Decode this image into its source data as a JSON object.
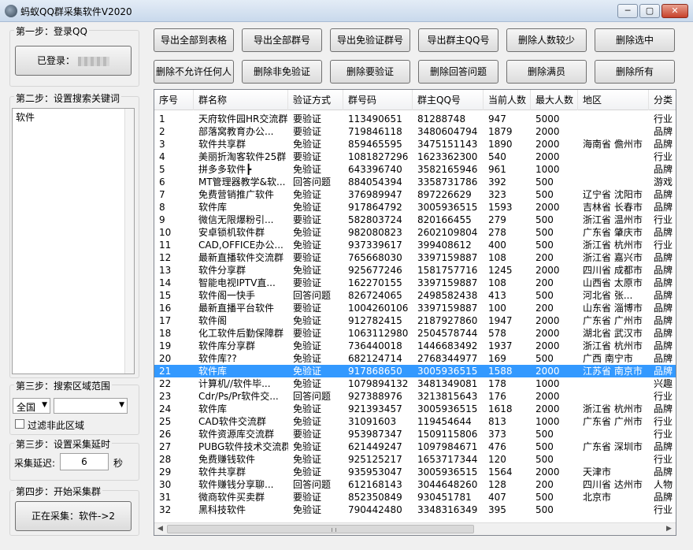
{
  "window": {
    "title": "蚂蚁QQ群采集软件V2020",
    "min": "─",
    "max": "▢",
    "close": "✕"
  },
  "step1": {
    "label": "第一步：登录QQ",
    "login_button": "已登录："
  },
  "step2": {
    "label": "第二步：设置搜索关键词",
    "keywords": "软件"
  },
  "step3a": {
    "label": "第三步：搜索区域范围",
    "region": "全国",
    "region2": "",
    "filter_label": "过滤非此区域"
  },
  "step3b": {
    "label": "第三步：设置采集延时",
    "delay_label": "采集延迟:",
    "delay_value": "6",
    "delay_unit": "秒"
  },
  "step4": {
    "label": "第四步：开始采集群",
    "collect_button": "正在采集：软件->2"
  },
  "toolbar": {
    "row1": [
      "导出全部到表格",
      "导出全部群号",
      "导出免验证群号",
      "导出群主QQ号",
      "删除人数较少",
      "删除选中"
    ],
    "row2": [
      "删除不允许任何人",
      "删除非免验证",
      "删除要验证",
      "删除回答问题",
      "删除满员",
      "删除所有"
    ]
  },
  "table": {
    "columns": [
      "序号",
      "群名称",
      "验证方式",
      "群号码",
      "群主QQ号",
      "当前人数",
      "最大人数",
      "地区",
      "分类"
    ],
    "selected_index": 20,
    "rows": [
      [
        "1",
        "天府软件园HR交流群",
        "要验证",
        "113490651",
        "81288748",
        "947",
        "5000",
        "",
        "行业"
      ],
      [
        "2",
        "部落窝教育办公...",
        "要验证",
        "719846118",
        "3480604794",
        "1879",
        "2000",
        "",
        "品牌"
      ],
      [
        "3",
        "软件共享群",
        "免验证",
        "859465595",
        "3475151143",
        "1890",
        "2000",
        "海南省 儋州市",
        "品牌"
      ],
      [
        "4",
        "美丽折淘客软件25群",
        "要验证",
        "1081827296",
        "1623362300",
        "540",
        "2000",
        "",
        "行业"
      ],
      [
        "5",
        "拼多多软件┣",
        "免验证",
        "643396740",
        "3582165946",
        "961",
        "1000",
        "",
        "品牌"
      ],
      [
        "6",
        "MT管理器教学&软...",
        "回答问题",
        "884054394",
        "3358731786",
        "392",
        "500",
        "",
        "游戏"
      ],
      [
        "7",
        "免费营销推广软件",
        "免验证",
        "376989947",
        "897226629",
        "323",
        "500",
        "辽宁省 沈阳市",
        "品牌"
      ],
      [
        "8",
        "软件库",
        "免验证",
        "917864792",
        "3005936515",
        "1593",
        "2000",
        "吉林省 长春市",
        "品牌"
      ],
      [
        "9",
        "微信无限爆粉引...",
        "要验证",
        "582803724",
        "820166455",
        "279",
        "500",
        "浙江省 温州市",
        "行业"
      ],
      [
        "10",
        "安卓锁机软件群",
        "免验证",
        "982080823",
        "2602109804",
        "278",
        "500",
        "广东省 肇庆市",
        "品牌"
      ],
      [
        "11",
        "CAD,OFFICE办公...",
        "免验证",
        "937339617",
        "399408612",
        "400",
        "500",
        "浙江省 杭州市",
        "行业"
      ],
      [
        "12",
        "最新直播软件交流群",
        "要验证",
        "765668030",
        "3397159887",
        "108",
        "200",
        "浙江省 嘉兴市",
        "品牌"
      ],
      [
        "13",
        "软件分享群",
        "免验证",
        "925677246",
        "1581757716",
        "1245",
        "2000",
        "四川省 成都市",
        "品牌"
      ],
      [
        "14",
        "智能电视IPTV直...",
        "要验证",
        "162270155",
        "3397159887",
        "108",
        "200",
        "山西省 太原市",
        "品牌"
      ],
      [
        "15",
        "软件阁一快手",
        "回答问题",
        "826724065",
        "2498582438",
        "413",
        "500",
        "河北省 张...",
        "品牌"
      ],
      [
        "16",
        "最新直播平台软件",
        "要验证",
        "1004260106",
        "3397159887",
        "100",
        "200",
        "山东省 淄博市",
        "品牌"
      ],
      [
        "17",
        "软件阁",
        "免验证",
        "912782415",
        "2187927860",
        "1947",
        "2000",
        "广东省 广州市",
        "品牌"
      ],
      [
        "18",
        "化工软件后勤保障群",
        "要验证",
        "1063112980",
        "2504578744",
        "578",
        "2000",
        "湖北省 武汉市",
        "品牌"
      ],
      [
        "19",
        "软件库分享群",
        "免验证",
        "736440018",
        "1446683492",
        "1937",
        "2000",
        "浙江省 杭州市",
        "品牌"
      ],
      [
        "20",
        "软件库??",
        "免验证",
        "682124714",
        "2768344977",
        "169",
        "500",
        "广西 南宁市",
        "品牌"
      ],
      [
        "21",
        "软件库",
        "免验证",
        "917868650",
        "3005936515",
        "1588",
        "2000",
        "江苏省 南京市",
        "品牌"
      ],
      [
        "22",
        "计算机//软件毕...",
        "免验证",
        "1079894132",
        "3481349081",
        "178",
        "1000",
        "",
        "兴趣"
      ],
      [
        "23",
        "Cdr/Ps/Pr软件交...",
        "回答问题",
        "927388976",
        "3213815643",
        "176",
        "2000",
        "",
        "行业"
      ],
      [
        "24",
        "软件库",
        "免验证",
        "921393457",
        "3005936515",
        "1618",
        "2000",
        "浙江省 杭州市",
        "品牌"
      ],
      [
        "25",
        "CAD软件交流群",
        "免验证",
        "31091603",
        "119454644",
        "813",
        "1000",
        "广东省 广州市",
        "行业"
      ],
      [
        "26",
        "软件资源库交流群",
        "要验证",
        "953987347",
        "1509115806",
        "373",
        "500",
        "",
        "行业"
      ],
      [
        "27",
        "PUBG软件技术交流群",
        "免验证",
        "621449247",
        "1097984671",
        "476",
        "500",
        "广东省 深圳市",
        "品牌"
      ],
      [
        "28",
        "免费赚钱软件",
        "免验证",
        "925125217",
        "1653717344",
        "120",
        "500",
        "",
        "行业"
      ],
      [
        "29",
        "软件共享群",
        "免验证",
        "935953047",
        "3005936515",
        "1564",
        "2000",
        "天津市",
        "品牌"
      ],
      [
        "30",
        "软件赚钱分享聊...",
        "回答问题",
        "612168143",
        "3044648260",
        "128",
        "200",
        "四川省 达州市",
        "人物"
      ],
      [
        "31",
        "微商软件买卖群",
        "要验证",
        "852350849",
        "930451781",
        "407",
        "500",
        "北京市",
        "品牌"
      ],
      [
        "32",
        "黑科技软件",
        "免验证",
        "790442480",
        "3348316349",
        "395",
        "500",
        "",
        "行业"
      ]
    ]
  }
}
